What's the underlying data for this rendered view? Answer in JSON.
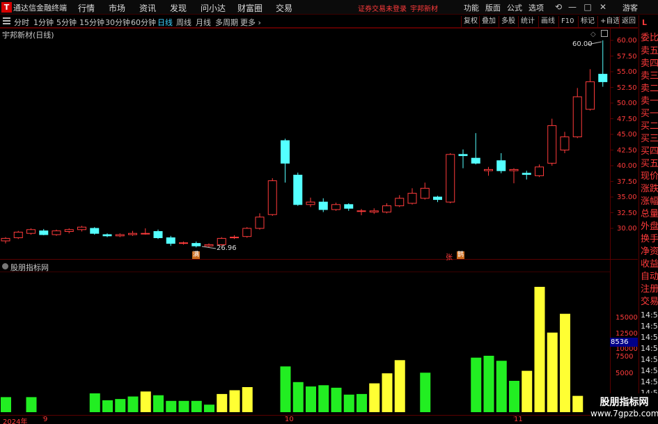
{
  "app": {
    "title": "通达信金融终端",
    "logo": "T"
  },
  "menus": [
    "行情",
    "市场",
    "资讯",
    "发现",
    "问小达",
    "财富圈",
    "交易"
  ],
  "status_message": "证券交易未登录",
  "stock_name": "宇邦新材",
  "top_menus": [
    "功能",
    "版面",
    "公式",
    "选项"
  ],
  "window_icons": [
    "minimize-icon",
    "maximize-icon",
    "close-icon"
  ],
  "guest_label": "游客",
  "periods": [
    "分时",
    "1分钟",
    "5分钟",
    "15分钟",
    "30分钟",
    "60分钟",
    "日线",
    "周线",
    "月线",
    "多周期",
    "更多"
  ],
  "active_period": "日线",
  "toolbar": [
    "复权",
    "叠加",
    "多股",
    "统计",
    "画线",
    "F10",
    "标记",
    "+自选",
    "返回"
  ],
  "price_chart_title": "宇邦新材(日线)",
  "indicator_title": "股朋指标网",
  "price_axis": [
    "60.00",
    "57.50",
    "55.00",
    "52.50",
    "50.00",
    "47.50",
    "45.00",
    "42.50",
    "40.00",
    "37.50",
    "35.00",
    "32.50",
    "30.00"
  ],
  "volume_axis": [
    "15000",
    "12500",
    "10000",
    "7500",
    "5000"
  ],
  "current_volume": "8536",
  "annotations": {
    "high": "60.00",
    "low": "26.96",
    "marker_1": "满",
    "marker_2": "张",
    "marker_3": "鹊"
  },
  "side_panel": {
    "letter": "L",
    "items": [
      "委比",
      "卖五",
      "卖四",
      "卖三",
      "卖二",
      "卖一",
      "买一",
      "买二",
      "买三",
      "买四",
      "买五",
      "现价",
      "涨跌",
      "涨幅",
      "总量",
      "外盘",
      "换手",
      "净资",
      "收益"
    ],
    "links": [
      "自动",
      "注册",
      "交易"
    ],
    "times": [
      "14:5",
      "14:5",
      "14:5",
      "14:5",
      "14:5",
      "14:5",
      "14:5",
      "14:5"
    ]
  },
  "x_axis_labels": [
    "2024年",
    "9",
    "10",
    "11"
  ],
  "watermark": {
    "title": "股朋指标网",
    "url": "www.7gpzb.com"
  },
  "colors": {
    "up": "#ff3b3b",
    "down": "#54ffff",
    "vol_green": "#22ee22",
    "vol_yellow": "#ffff33",
    "grid": "#5a0000"
  },
  "chart_data": {
    "type": "candlestick",
    "ylim": [
      27,
      61
    ],
    "candles": [
      {
        "o": 28.0,
        "h": 28.6,
        "l": 27.6,
        "c": 28.4
      },
      {
        "o": 28.5,
        "h": 29.6,
        "l": 28.3,
        "c": 29.4
      },
      {
        "o": 29.2,
        "h": 30.0,
        "l": 29.0,
        "c": 29.8
      },
      {
        "o": 29.6,
        "h": 29.9,
        "l": 28.9,
        "c": 29.0
      },
      {
        "o": 29.0,
        "h": 29.8,
        "l": 28.8,
        "c": 29.6
      },
      {
        "o": 29.5,
        "h": 30.0,
        "l": 29.2,
        "c": 29.8
      },
      {
        "o": 29.8,
        "h": 30.4,
        "l": 29.5,
        "c": 30.2
      },
      {
        "o": 30.0,
        "h": 30.2,
        "l": 29.0,
        "c": 29.2
      },
      {
        "o": 29.0,
        "h": 29.2,
        "l": 28.6,
        "c": 28.8
      },
      {
        "o": 28.8,
        "h": 29.2,
        "l": 28.6,
        "c": 29.0
      },
      {
        "o": 29.0,
        "h": 29.6,
        "l": 28.8,
        "c": 29.2
      },
      {
        "o": 29.2,
        "h": 30.0,
        "l": 29.0,
        "c": 29.2
      },
      {
        "o": 29.5,
        "h": 29.8,
        "l": 28.3,
        "c": 28.5
      },
      {
        "o": 28.5,
        "h": 28.8,
        "l": 27.2,
        "c": 27.6
      },
      {
        "o": 27.6,
        "h": 27.9,
        "l": 27.4,
        "c": 27.7
      },
      {
        "o": 27.6,
        "h": 27.9,
        "l": 26.96,
        "c": 27.2
      },
      {
        "o": 27.2,
        "h": 27.6,
        "l": 27.0,
        "c": 27.4
      },
      {
        "o": 27.4,
        "h": 28.6,
        "l": 27.2,
        "c": 28.4
      },
      {
        "o": 28.6,
        "h": 28.9,
        "l": 28.3,
        "c": 28.6
      },
      {
        "o": 28.7,
        "h": 30.2,
        "l": 28.5,
        "c": 30.0
      },
      {
        "o": 30.0,
        "h": 32.4,
        "l": 29.8,
        "c": 31.8
      },
      {
        "o": 32.2,
        "h": 38.0,
        "l": 32.0,
        "c": 37.6
      },
      {
        "o": 44.0,
        "h": 44.3,
        "l": 37.3,
        "c": 40.4
      },
      {
        "o": 38.5,
        "h": 38.9,
        "l": 33.6,
        "c": 33.8
      },
      {
        "o": 33.8,
        "h": 34.9,
        "l": 33.4,
        "c": 34.2
      },
      {
        "o": 34.2,
        "h": 34.8,
        "l": 32.6,
        "c": 33.0
      },
      {
        "o": 33.0,
        "h": 34.1,
        "l": 32.8,
        "c": 33.8
      },
      {
        "o": 33.8,
        "h": 34.0,
        "l": 32.8,
        "c": 33.2
      },
      {
        "o": 32.8,
        "h": 33.1,
        "l": 32.1,
        "c": 32.8
      },
      {
        "o": 32.6,
        "h": 33.2,
        "l": 32.3,
        "c": 32.8
      },
      {
        "o": 32.6,
        "h": 34.0,
        "l": 32.4,
        "c": 33.6
      },
      {
        "o": 33.6,
        "h": 35.3,
        "l": 33.4,
        "c": 34.8
      },
      {
        "o": 34.0,
        "h": 36.4,
        "l": 33.8,
        "c": 35.6
      },
      {
        "o": 34.8,
        "h": 37.3,
        "l": 34.6,
        "c": 36.4
      },
      {
        "o": 35.0,
        "h": 35.2,
        "l": 34.2,
        "c": 34.6
      },
      {
        "o": 34.2,
        "h": 42.0,
        "l": 34.0,
        "c": 41.8
      },
      {
        "o": 41.8,
        "h": 42.6,
        "l": 39.6,
        "c": 41.6
      },
      {
        "o": 41.2,
        "h": 45.2,
        "l": 40.2,
        "c": 40.4
      },
      {
        "o": 39.2,
        "h": 39.8,
        "l": 38.4,
        "c": 39.4
      },
      {
        "o": 40.8,
        "h": 42.0,
        "l": 38.8,
        "c": 39.2
      },
      {
        "o": 39.2,
        "h": 39.6,
        "l": 37.2,
        "c": 39.4
      },
      {
        "o": 38.8,
        "h": 39.2,
        "l": 37.8,
        "c": 38.6
      },
      {
        "o": 38.4,
        "h": 40.2,
        "l": 38.2,
        "c": 39.8
      },
      {
        "o": 40.4,
        "h": 47.5,
        "l": 40.0,
        "c": 46.4
      },
      {
        "o": 42.5,
        "h": 45.4,
        "l": 42.0,
        "c": 44.6
      },
      {
        "o": 44.6,
        "h": 52.4,
        "l": 44.4,
        "c": 51.0
      },
      {
        "o": 49.0,
        "h": 55.4,
        "l": 48.8,
        "c": 53.4
      },
      {
        "o": 54.6,
        "h": 60.0,
        "l": 52.6,
        "c": 53.4
      }
    ],
    "volume": [
      {
        "v": 2400,
        "c": "g"
      },
      {
        "v": 0,
        "c": "g"
      },
      {
        "v": 2400,
        "c": "g"
      },
      {
        "v": 0,
        "c": "g"
      },
      {
        "v": 0,
        "c": "g"
      },
      {
        "v": 0,
        "c": "g"
      },
      {
        "v": 0,
        "c": "g"
      },
      {
        "v": 3000,
        "c": "g"
      },
      {
        "v": 1900,
        "c": "g"
      },
      {
        "v": 2100,
        "c": "g"
      },
      {
        "v": 2500,
        "c": "g"
      },
      {
        "v": 3300,
        "c": "y"
      },
      {
        "v": 2700,
        "c": "g"
      },
      {
        "v": 1800,
        "c": "g"
      },
      {
        "v": 1800,
        "c": "g"
      },
      {
        "v": 1800,
        "c": "g"
      },
      {
        "v": 1200,
        "c": "g"
      },
      {
        "v": 2900,
        "c": "y"
      },
      {
        "v": 3500,
        "c": "y"
      },
      {
        "v": 4000,
        "c": "y"
      },
      {
        "v": 0,
        "c": "g"
      },
      {
        "v": 0,
        "c": "g"
      },
      {
        "v": 7300,
        "c": "g"
      },
      {
        "v": 4800,
        "c": "g"
      },
      {
        "v": 4100,
        "c": "g"
      },
      {
        "v": 4300,
        "c": "g"
      },
      {
        "v": 3900,
        "c": "g"
      },
      {
        "v": 2800,
        "c": "g"
      },
      {
        "v": 2900,
        "c": "g"
      },
      {
        "v": 4600,
        "c": "y"
      },
      {
        "v": 6200,
        "c": "y"
      },
      {
        "v": 8300,
        "c": "y"
      },
      {
        "v": 0,
        "c": "g"
      },
      {
        "v": 6300,
        "c": "g"
      },
      {
        "v": 0,
        "c": "g"
      },
      {
        "v": 0,
        "c": "g"
      },
      {
        "v": 0,
        "c": "g"
      },
      {
        "v": 8700,
        "c": "g"
      },
      {
        "v": 9000,
        "c": "g"
      },
      {
        "v": 8200,
        "c": "g"
      },
      {
        "v": 5000,
        "c": "g"
      },
      {
        "v": 6600,
        "c": "y"
      },
      {
        "v": 20000,
        "c": "y"
      },
      {
        "v": 12700,
        "c": "y"
      },
      {
        "v": 15700,
        "c": "y"
      },
      {
        "v": 2600,
        "c": "y"
      }
    ]
  }
}
